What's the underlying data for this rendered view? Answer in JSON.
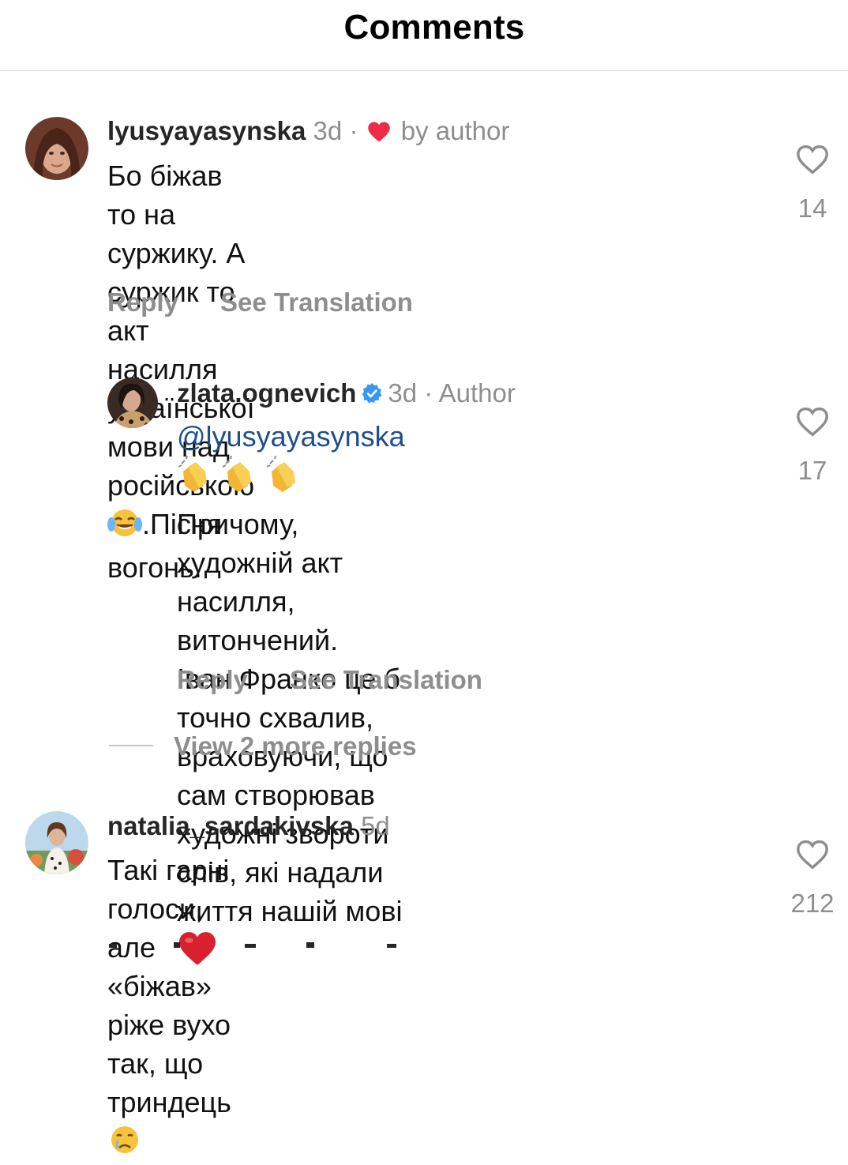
{
  "header": {
    "title": "Comments"
  },
  "comments": [
    {
      "username": "lyusyayasynska",
      "time": "3d",
      "sep": "·",
      "liked_by": "by author",
      "text_line1": "Бо біжав то на суржику. А суржик то акт",
      "text_line2": "насилля української мови над російською",
      "text_line3": ".Пісня вогонь.",
      "reply_label": "Reply",
      "translate_label": "See Translation",
      "like_count": "14"
    },
    {
      "username": "zlata.ognevich",
      "time": "3d",
      "sep": "·",
      "role": "Author",
      "mention": "@lyusyayasynska",
      "text_line1_rest": "Причому,",
      "text_line2": "художній акт насилля, витончений.",
      "text_line3": "Іван Франко це б точно схвалив,",
      "text_line4": "враховуючи, що сам створював",
      "text_line5": "художні звороти слів, які надали",
      "text_line6": "життя нашій мові",
      "reply_label": "Reply",
      "translate_label": "See Translation",
      "like_count": "17"
    },
    {
      "username": "natalia_sardakivska",
      "time": "5d",
      "text_line1": "Такі гарні голоси, але «біжав» ріже вухо",
      "text_line2": "так, що триндець",
      "like_count": "212"
    }
  ],
  "view_more": {
    "label": "View 2 more replies"
  },
  "icons": {
    "heart_outline": "heart-outline-icon",
    "heart_filled": "heart-filled-icon",
    "verified": "verified-badge-icon",
    "laughing": "tears-of-joy-emoji",
    "clapping": "clapping-hands-emoji",
    "red_heart": "red-heart-emoji",
    "crying": "crying-face-emoji"
  },
  "colors": {
    "like_red": "#ed2d45",
    "verified_blue": "#3897f0",
    "mention_blue": "#1f4f8a",
    "muted": "#8e8e8e"
  }
}
